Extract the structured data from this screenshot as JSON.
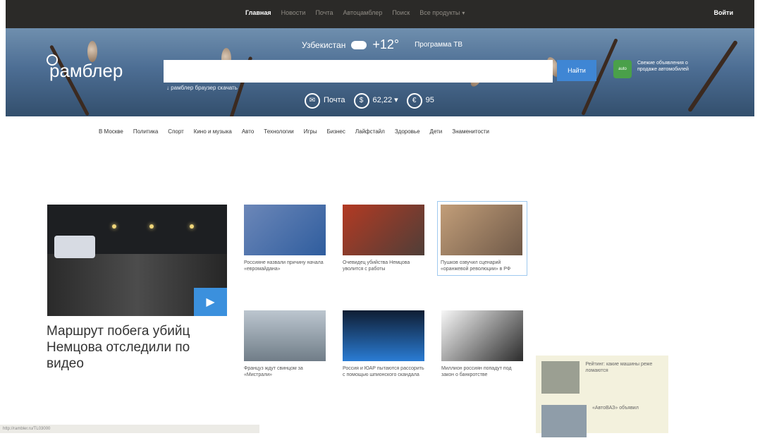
{
  "topnav": {
    "items": [
      "Главная",
      "Новости",
      "Почта",
      "Автоцамблер",
      "Поиск",
      "Все продукты"
    ],
    "login": "Войти"
  },
  "hero": {
    "logo": "рамблер",
    "search_placeholder": "",
    "search_button": "Найти",
    "browser_link": "рамблер браузер скачать",
    "weather_region": "Узбекистан",
    "weather_temp": "+12°",
    "tv_link": "Программа ТВ",
    "mail": "Почта",
    "usd": "62,22",
    "eur": "95",
    "promo_text": "Свежие объявления о продаже автомобилей",
    "promo_icon": "auto"
  },
  "categories": [
    "В Москве",
    "Политика",
    "Спорт",
    "Кино и музыка",
    "Авто",
    "Технологии",
    "Игры",
    "Бизнес",
    "Лайфстайл",
    "Здоровье",
    "Дети",
    "Знаменитости"
  ],
  "lead": {
    "title": "Маршрут побега убийц Немцова отследили по видео"
  },
  "cards": [
    {
      "text": "Россияне назвали причину начала «евромайдана»"
    },
    {
      "text": "Очевидец убийства Немцова уволится с работы"
    },
    {
      "text": "Пушков озвучил сценарий «оранжевой революции» в РФ"
    },
    {
      "text": "Француз ждут свинцом за «Мистрали»"
    },
    {
      "text": "Россия и ЮАР пытаются рассорить с помощью шпионского скандала"
    },
    {
      "text": "Миллион россиян попадут под закон о банкротстве"
    }
  ],
  "side": [
    {
      "text": "Рейтинг: какие машины реже ломаются"
    },
    {
      "text": "«АвтоВАЗ» объявил"
    }
  ],
  "statusbar": "http://rambler.ru/TL03000"
}
